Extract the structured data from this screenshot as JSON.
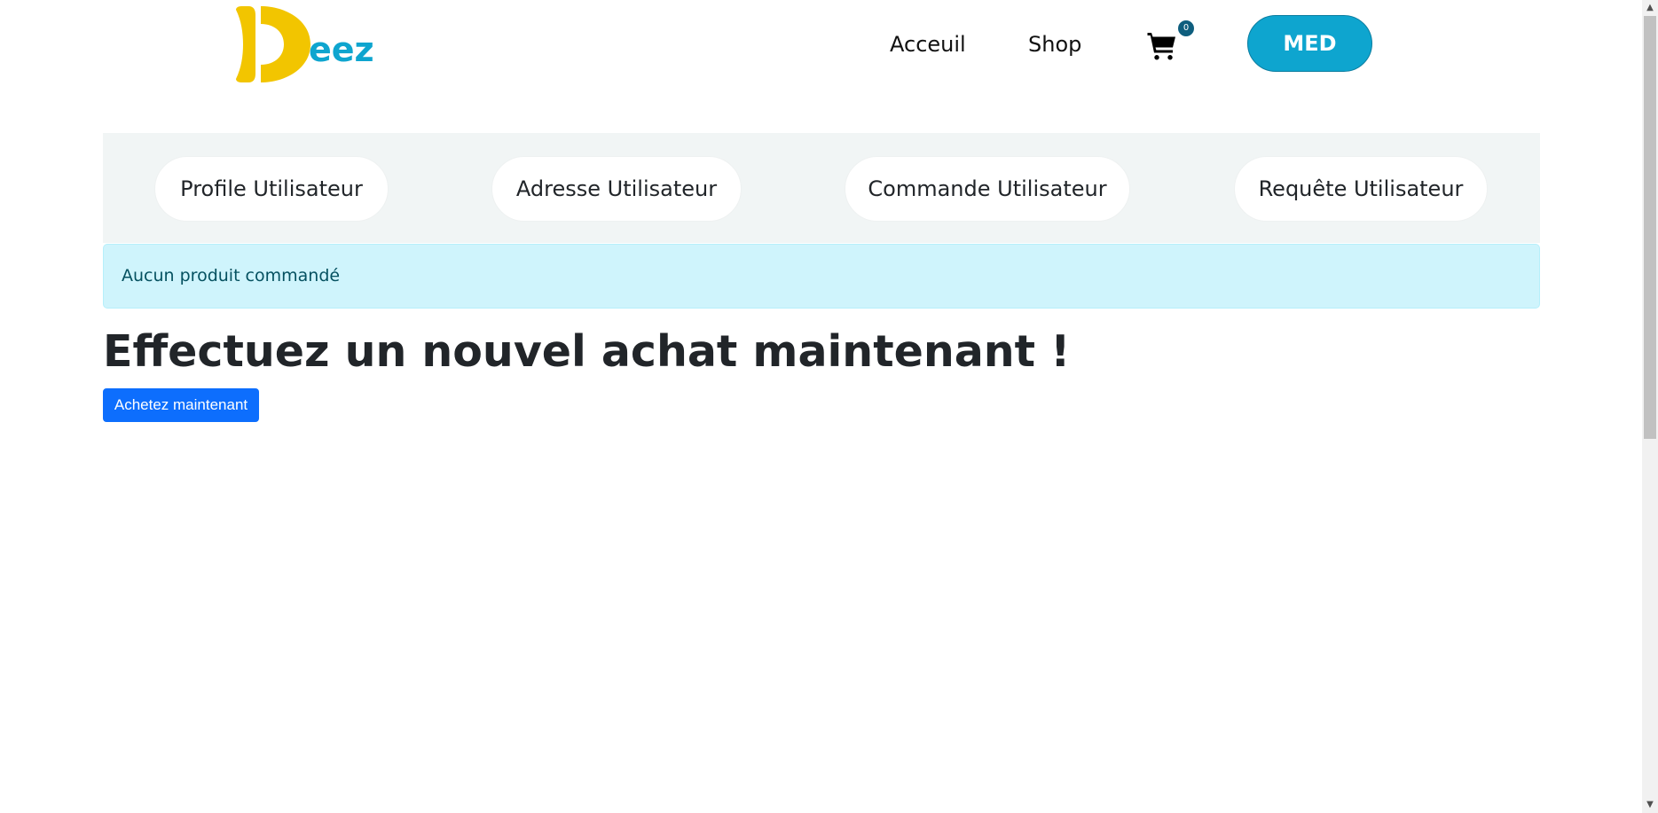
{
  "brand": {
    "logo_text": "eez",
    "logo_letter": "D",
    "colors": {
      "yellow": "#f2c500",
      "blue": "#0ea5cf"
    }
  },
  "nav": {
    "home_label": "Acceuil",
    "shop_label": "Shop",
    "cart_count": "0",
    "user_label": "MED"
  },
  "tabs": [
    {
      "label": "Profile Utilisateur"
    },
    {
      "label": "Adresse Utilisateur"
    },
    {
      "label": "Commande Utilisateur"
    },
    {
      "label": "Requête Utilisateur"
    }
  ],
  "alert": {
    "text": "Aucun produit commandé"
  },
  "main": {
    "headline": "Effectuez un nouvel achat maintenant !",
    "cta_label": "Achetez maintenant"
  },
  "colors": {
    "primary": "#0d6efd",
    "info_bg": "#cff4fc",
    "info_text": "#055160",
    "panel_bg": "#f1f5f5"
  }
}
